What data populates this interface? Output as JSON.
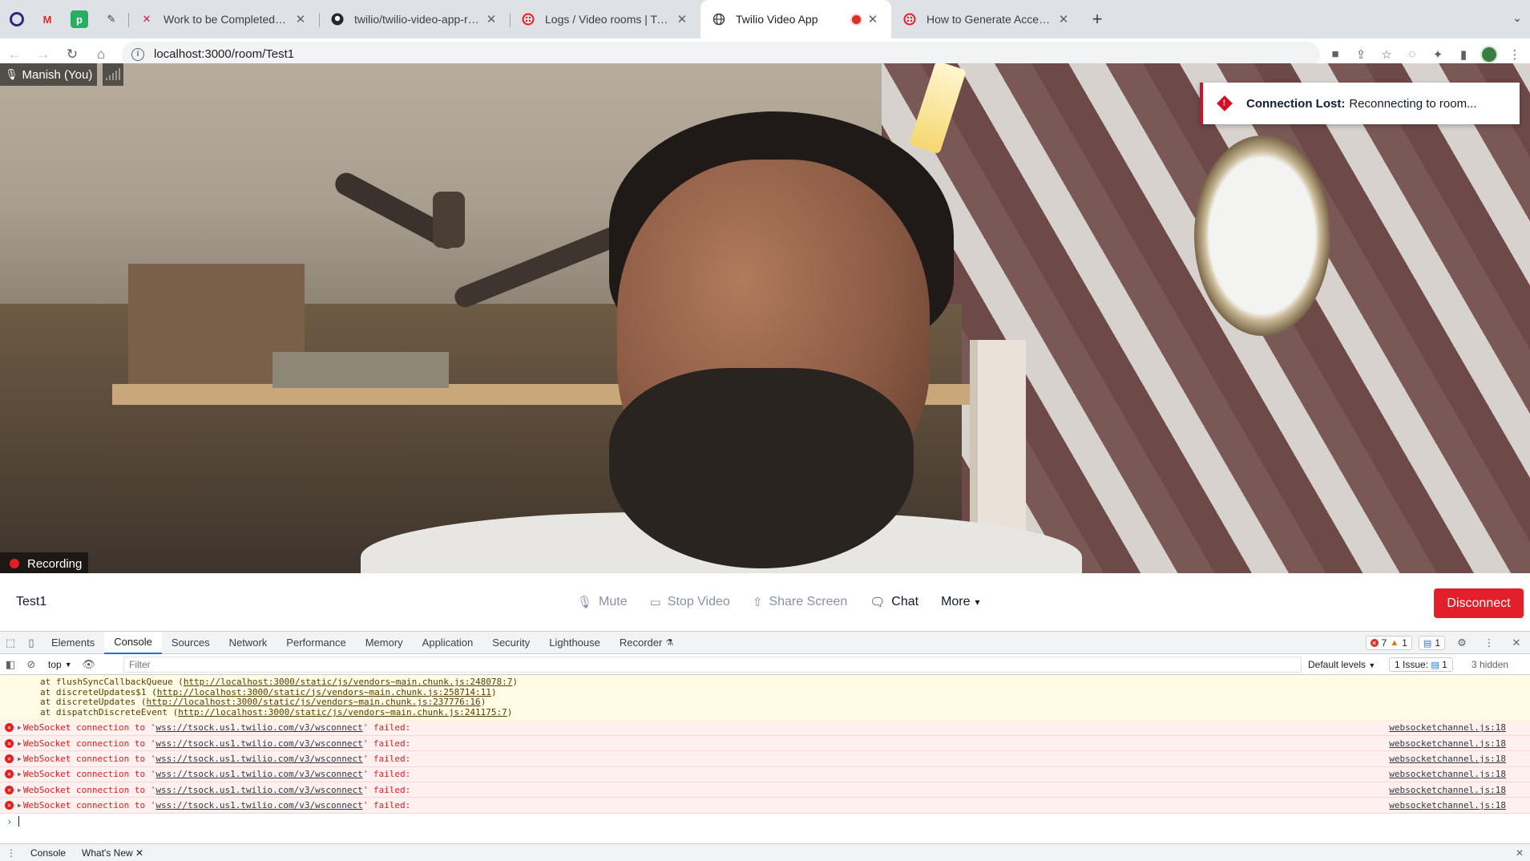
{
  "browser": {
    "pinned_tabs": [
      {
        "icon": "opera-icon",
        "glyph": "O",
        "color": "#2b2b80"
      },
      {
        "icon": "gmail-icon",
        "glyph": "M",
        "color": "#d93025"
      },
      {
        "icon": "p-app-icon",
        "glyph": "p",
        "color": "#27ae60"
      },
      {
        "icon": "brush-icon",
        "glyph": "✎",
        "color": "#3c4043"
      }
    ],
    "tabs": [
      {
        "title": "Work to be Completed during G",
        "icon": "x-logo-icon"
      },
      {
        "title": "twilio/twilio-video-app-react: A",
        "icon": "github-icon"
      },
      {
        "title": "Logs / Video rooms | Twilio",
        "icon": "twilio-icon"
      },
      {
        "title": "Twilio Video App",
        "icon": "globe-icon",
        "active": true,
        "recording": true
      },
      {
        "title": "How to Generate Access Token",
        "icon": "twilio-icon"
      }
    ],
    "url": "localhost:3000/room/Test1"
  },
  "video": {
    "participant_name": "Manish (You)",
    "recording_label": "Recording",
    "toast": {
      "title": "Connection Lost:",
      "message": "Reconnecting to room..."
    }
  },
  "footer": {
    "room_name": "Test1",
    "mute": "Mute",
    "stop_video": "Stop Video",
    "share_screen": "Share Screen",
    "chat": "Chat",
    "more": "More",
    "disconnect": "Disconnect"
  },
  "devtools": {
    "tabs": [
      "Elements",
      "Console",
      "Sources",
      "Network",
      "Performance",
      "Memory",
      "Application",
      "Security",
      "Lighthouse",
      "Recorder"
    ],
    "active_tab": "Console",
    "error_count": "7",
    "warning_count": "1",
    "message_count": "1",
    "context": "top",
    "filter_placeholder": "Filter",
    "levels": "Default levels",
    "issues": "1 Issue:",
    "issues_count": "1",
    "hidden": "3 hidden",
    "stack": [
      {
        "prefix": "at flushSyncCallbackQueue (",
        "url": "http://localhost:3000/static/js/vendors~main.chunk.js:248078:7",
        "suffix": ")"
      },
      {
        "prefix": "at discreteUpdates$1 (",
        "url": "http://localhost:3000/static/js/vendors~main.chunk.js:258714:11",
        "suffix": ")"
      },
      {
        "prefix": "at discreteUpdates (",
        "url": "http://localhost:3000/static/js/vendors~main.chunk.js:237776:16",
        "suffix": ")"
      },
      {
        "prefix": "at dispatchDiscreteEvent (",
        "url": "http://localhost:3000/static/js/vendors~main.chunk.js:241175:7",
        "suffix": ")"
      }
    ],
    "errors": [
      {
        "prefix": "WebSocket connection to '",
        "url": "wss://tsock.us1.twilio.com/v3/wsconnect",
        "suffix": "' failed:",
        "source": "websocketchannel.js:18"
      },
      {
        "prefix": "WebSocket connection to '",
        "url": "wss://tsock.us1.twilio.com/v3/wsconnect",
        "suffix": "' failed:",
        "source": "websocketchannel.js:18"
      },
      {
        "prefix": "WebSocket connection to '",
        "url": "wss://tsock.us1.twilio.com/v3/wsconnect",
        "suffix": "' failed:",
        "source": "websocketchannel.js:18"
      },
      {
        "prefix": "WebSocket connection to '",
        "url": "wss://tsock.us1.twilio.com/v3/wsconnect",
        "suffix": "' failed:",
        "source": "websocketchannel.js:18"
      },
      {
        "prefix": "WebSocket connection to '",
        "url": "wss://tsock.us1.twilio.com/v3/wsconnect",
        "suffix": "' failed:",
        "source": "websocketchannel.js:18"
      },
      {
        "prefix": "WebSocket connection to '",
        "url": "wss://tsock.us1.twilio.com/v3/wsconnect",
        "suffix": "' failed:",
        "source": "websocketchannel.js:18"
      }
    ],
    "drawer_tabs": [
      "Console",
      "What's New"
    ]
  }
}
